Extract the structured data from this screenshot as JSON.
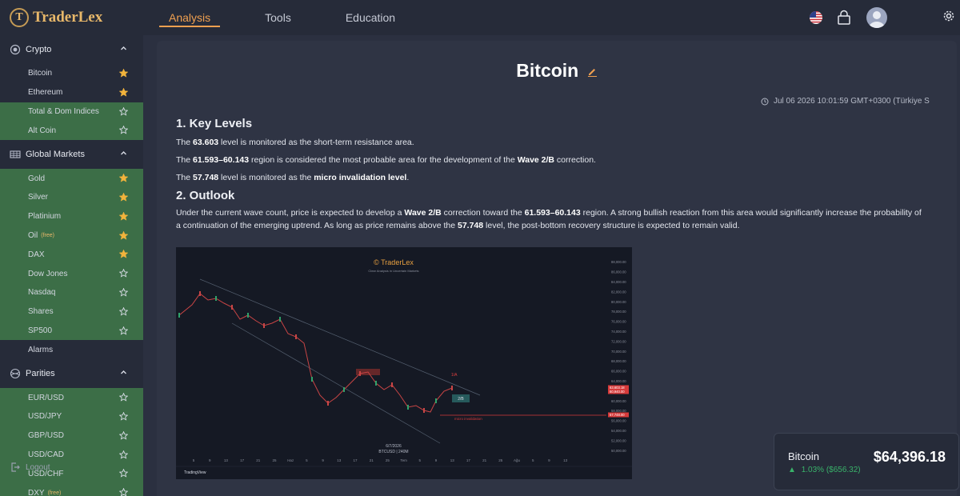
{
  "brand": {
    "logo_letter": "T",
    "name": "TraderLex"
  },
  "nav": {
    "tabs": [
      {
        "label": "Analysis",
        "active": true
      },
      {
        "label": "Tools",
        "active": false
      },
      {
        "label": "Education",
        "active": false
      }
    ]
  },
  "topbar_icons": [
    "us-flag-icon",
    "lock-icon",
    "avatar",
    "gear-icon"
  ],
  "sidebar": {
    "sections": [
      {
        "label": "Crypto",
        "icon": "crypto-icon",
        "items": [
          {
            "label": "Bitcoin",
            "starred": true,
            "green": false
          },
          {
            "label": "Ethereum",
            "starred": true,
            "green": false
          },
          {
            "label": "Total & Dom Indices",
            "starred": false,
            "green": true
          },
          {
            "label": "Alt Coin",
            "starred": false,
            "green": true
          }
        ]
      },
      {
        "label": "Global Markets",
        "icon": "globe-markets-icon",
        "items": [
          {
            "label": "Gold",
            "starred": true,
            "green": true
          },
          {
            "label": "Silver",
            "starred": true,
            "green": true
          },
          {
            "label": "Platinium",
            "starred": true,
            "green": true
          },
          {
            "label": "Oil",
            "tag": "(free)",
            "starred": true,
            "green": true
          },
          {
            "label": "DAX",
            "starred": true,
            "green": true
          },
          {
            "label": "Dow Jones",
            "starred": false,
            "green": true
          },
          {
            "label": "Nasdaq",
            "starred": false,
            "green": true
          },
          {
            "label": "Shares",
            "starred": false,
            "green": true
          },
          {
            "label": "SP500",
            "starred": false,
            "green": true
          },
          {
            "label": "Alarms",
            "starred": null,
            "green": false
          }
        ]
      },
      {
        "label": "Parities",
        "icon": "parities-icon",
        "items": [
          {
            "label": "EUR/USD",
            "starred": false,
            "green": true
          },
          {
            "label": "USD/JPY",
            "starred": false,
            "green": true
          },
          {
            "label": "GBP/USD",
            "starred": false,
            "green": true
          },
          {
            "label": "USD/CAD",
            "starred": false,
            "green": true
          },
          {
            "label": "USD/CHF",
            "starred": false,
            "green": true
          },
          {
            "label": "DXY",
            "tag": "(free)",
            "starred": false,
            "green": true
          }
        ]
      }
    ],
    "logout_label": "Logout"
  },
  "article": {
    "title": "Bitcoin",
    "timestamp": "Jul 06 2026 10:01:59 GMT+0300 (Türkiye S",
    "section1_heading": "1. Key Levels",
    "key_levels": [
      [
        {
          "t": "The "
        },
        {
          "t": "63.603",
          "b": true
        },
        {
          "t": " level is monitored as the short-term resistance area."
        }
      ],
      [
        {
          "t": "The "
        },
        {
          "t": "61.593–60.143",
          "b": true
        },
        {
          "t": " region is considered the most probable area for the development of the "
        },
        {
          "t": "Wave 2/B",
          "b": true
        },
        {
          "t": " correction."
        }
      ],
      [
        {
          "t": "The "
        },
        {
          "t": "57.748",
          "b": true
        },
        {
          "t": " level is monitored as the "
        },
        {
          "t": "micro invalidation level",
          "b": true
        },
        {
          "t": "."
        }
      ]
    ],
    "section2_heading": "2. Outlook",
    "outlook": [
      {
        "t": "Under the current wave count, price is expected to develop a "
      },
      {
        "t": "Wave 2/B",
        "b": true
      },
      {
        "t": " correction toward the "
      },
      {
        "t": "61.593–60.143",
        "b": true
      },
      {
        "t": " region. A strong bullish reaction from this area would significantly increase the probability of a continuation of the emerging uptrend. As long as price remains above the "
      },
      {
        "t": "57.748",
        "b": true
      },
      {
        "t": " level, the post-bottom recovery structure is expected to remain valid."
      }
    ]
  },
  "chart_image": {
    "watermark": "© TraderLex",
    "tagline": "Clear Analysis in Uncertain Markets",
    "date_label": "6/7/2026",
    "symbol_label": "BTCUSD | 240M",
    "footer_brand": "TradingView",
    "annotation_invalidation": "micro invalidation",
    "annotation_wave": "2/B",
    "annotation_target": "1/A",
    "y_ticks": [
      "88,000.00",
      "86,000.00",
      "84,000.00",
      "82,000.00",
      "80,000.00",
      "78,000.00",
      "76,000.00",
      "74,000.00",
      "72,000.00",
      "70,000.00",
      "68,000.00",
      "66,000.00",
      "64,000.00",
      "62,000.00",
      "60,000.00",
      "58,000.00",
      "56,000.00",
      "54,000.00",
      "52,000.00",
      "50,000.00"
    ],
    "x_ticks": [
      "5",
      "9",
      "13",
      "17",
      "21",
      "25",
      "Haz",
      "5",
      "9",
      "13",
      "17",
      "21",
      "25",
      "Tem",
      "5",
      "9",
      "13",
      "17",
      "21",
      "25",
      "Ağu",
      "5",
      "9",
      "13"
    ],
    "price_tags": [
      {
        "label": "63,603.18",
        "color": "#d63a3a"
      },
      {
        "label": "60,940.00",
        "color": "#d63a3a"
      },
      {
        "label": "57,748.00",
        "color": "#d63a3a"
      }
    ]
  },
  "ticker": {
    "name": "Bitcoin",
    "price": "$64,396.18",
    "change": "1.03% ($656.32)",
    "change_color": "#39b36a"
  }
}
